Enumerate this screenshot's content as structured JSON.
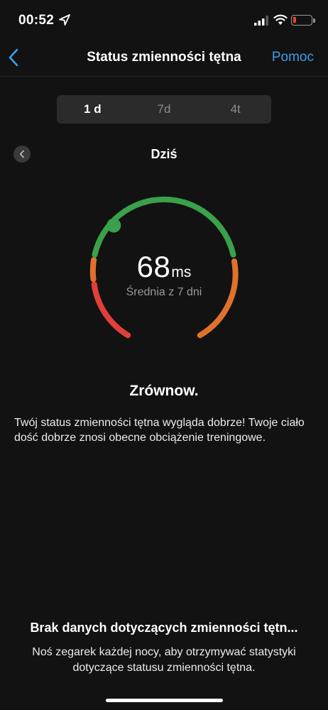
{
  "status_bar": {
    "time": "00:52",
    "icons": [
      "location-arrow-icon",
      "cellular-signal-icon",
      "wifi-icon",
      "battery-low-icon"
    ]
  },
  "nav": {
    "back_icon": "chevron-left-icon",
    "title": "Status zmienności tętna",
    "help_label": "Pomoc"
  },
  "tabs": [
    {
      "label": "1 d",
      "active": true
    },
    {
      "label": "7d",
      "active": false
    },
    {
      "label": "4t",
      "active": false
    }
  ],
  "date": {
    "prev_icon": "chevron-left-icon",
    "label": "Dziś"
  },
  "gauge": {
    "value": "68",
    "unit": "ms",
    "subtitle": "Średnia z 7 dni",
    "colors": {
      "balanced": "#3aa14a",
      "unbalanced": "#e0712d",
      "low": "#e0403a"
    }
  },
  "status": {
    "title": "Zrównow.",
    "description": "Twój status zmienności tętna wygląda dobrze! Twoje ciało dość dobrze znosi obecne obciążenie treningowe."
  },
  "no_data": {
    "title": "Brak danych dotyczących zmienności tętn...",
    "description": "Noś zegarek każdej nocy, aby otrzymywać statystyki dotyczące statusu zmienności tętna."
  },
  "accent_color": "#3b9eea"
}
